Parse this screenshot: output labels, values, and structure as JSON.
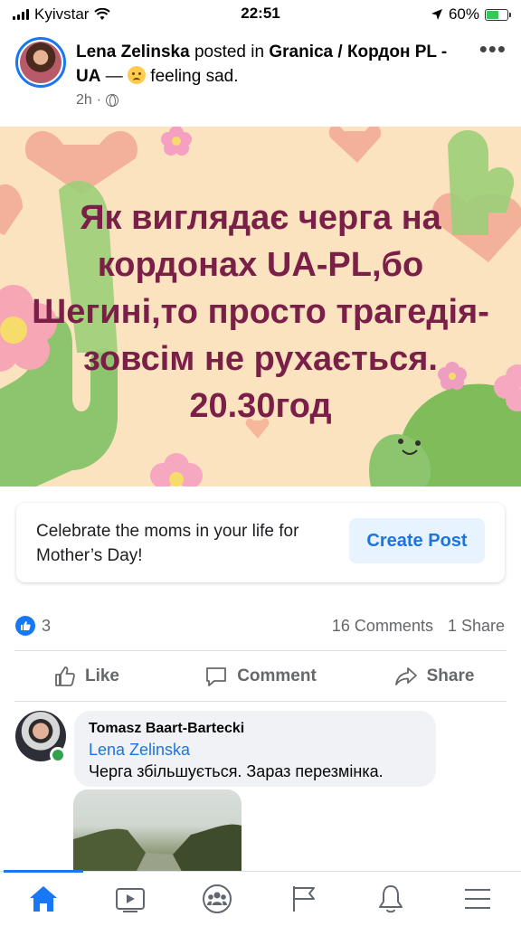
{
  "status_bar": {
    "carrier": "Kyivstar",
    "time": "22:51",
    "battery": "60%",
    "battery_level": 0.6
  },
  "post": {
    "author": "Lena Zelinska",
    "posted_in": "posted in",
    "group": "Granica / Кордон PL - UA",
    "dash": "—",
    "feeling": "feeling sad.",
    "time": "2h",
    "separator": "·",
    "privacy_icon": "globe-icon",
    "more_icon": "more-dots-icon",
    "more_label": "•••"
  },
  "image": {
    "text": "Як виглядає черга на кордонах UA-PL,бо Шегині,то просто трагедія-зовсім не рухається. 20.30год",
    "text_color": "#7a1f47",
    "background_color": "#fbe3c0"
  },
  "promo": {
    "text": "Celebrate the moms in your life for Mother’s Day!",
    "button": "Create Post"
  },
  "reactions": {
    "like_count": "3",
    "comments": "16 Comments",
    "shares": "1 Share"
  },
  "actions": {
    "like": "Like",
    "comment": "Comment",
    "share": "Share"
  },
  "comment": {
    "author": "Tomasz Baart-Bartecki",
    "tag": "Lena Zelinska",
    "text": "Черга збільшується. Зараз перезмінка."
  },
  "tab_bar": {
    "active": "home",
    "accent": "#1877f2",
    "icons": [
      "home-icon",
      "video-icon",
      "groups-icon",
      "flag-icon",
      "bell-icon",
      "menu-icon"
    ]
  }
}
